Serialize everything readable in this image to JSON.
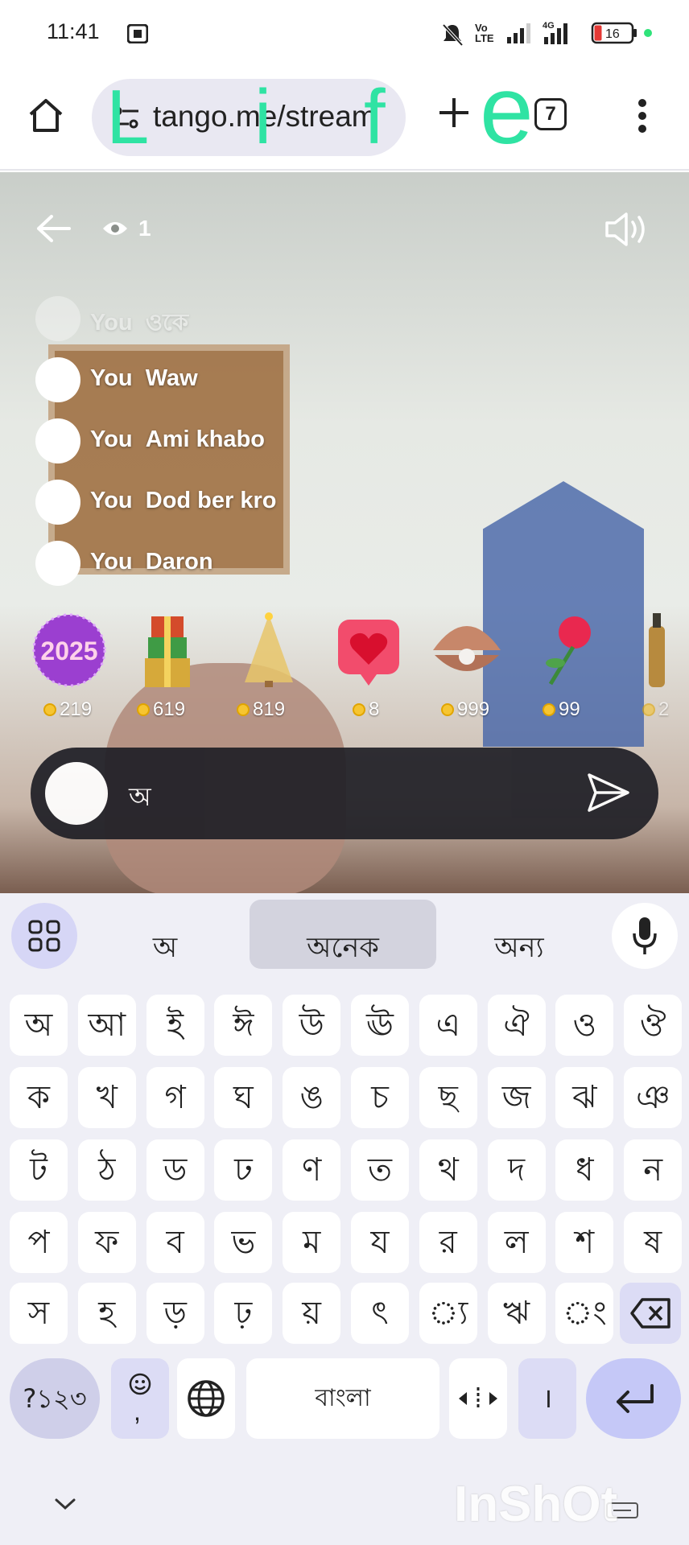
{
  "status_bar": {
    "time": "11:41",
    "battery": "16",
    "network": "4G"
  },
  "browser": {
    "url": "tango.me/stream",
    "tab_count": "7",
    "overlay_letters": [
      "L",
      "i",
      "f",
      "e"
    ]
  },
  "stream": {
    "viewer_count": "1",
    "chat": [
      {
        "user": "You",
        "message": "ওকে"
      },
      {
        "user": "You",
        "message": "Waw"
      },
      {
        "user": "You",
        "message": "Ami khabo"
      },
      {
        "user": "You",
        "message": "Dod ber kro"
      },
      {
        "user": "You",
        "message": "Daron"
      }
    ],
    "gifts": [
      {
        "name": "2025",
        "price": "219"
      },
      {
        "name": "gift-boxes",
        "price": "619"
      },
      {
        "name": "christmas-tree",
        "price": "819"
      },
      {
        "name": "heart",
        "price": "8"
      },
      {
        "name": "pearl-shell",
        "price": "999"
      },
      {
        "name": "rose",
        "price": "99"
      },
      {
        "name": "bottle",
        "price": "2"
      }
    ],
    "comment_input": "অ"
  },
  "keyboard": {
    "suggestions": [
      "অ",
      "অনেক",
      "অন্য"
    ],
    "rows": [
      [
        "অ",
        "আ",
        "ই",
        "ঈ",
        "উ",
        "ঊ",
        "এ",
        "ঐ",
        "ও",
        "ঔ"
      ],
      [
        "ক",
        "খ",
        "গ",
        "ঘ",
        "ঙ",
        "চ",
        "ছ",
        "জ",
        "ঝ",
        "ঞ"
      ],
      [
        "ট",
        "ঠ",
        "ড",
        "ঢ",
        "ণ",
        "ত",
        "থ",
        "দ",
        "ধ",
        "ন"
      ],
      [
        "প",
        "ফ",
        "ব",
        "ভ",
        "ম",
        "য",
        "র",
        "ল",
        "শ",
        "ষ"
      ],
      [
        "স",
        "হ",
        "ড়",
        "ঢ়",
        "য়",
        "ৎ",
        "্য",
        "ঋ",
        "ং"
      ]
    ],
    "symbols_label": "?১২৩",
    "emoji_comma": ",",
    "space_label": "বাংলা",
    "period_label": "।"
  },
  "watermark": "InShOt",
  "colors": {
    "accent_green": "#2fe3a3",
    "key_special": "#dcdcf5",
    "enter_key": "#c5c8f7"
  }
}
